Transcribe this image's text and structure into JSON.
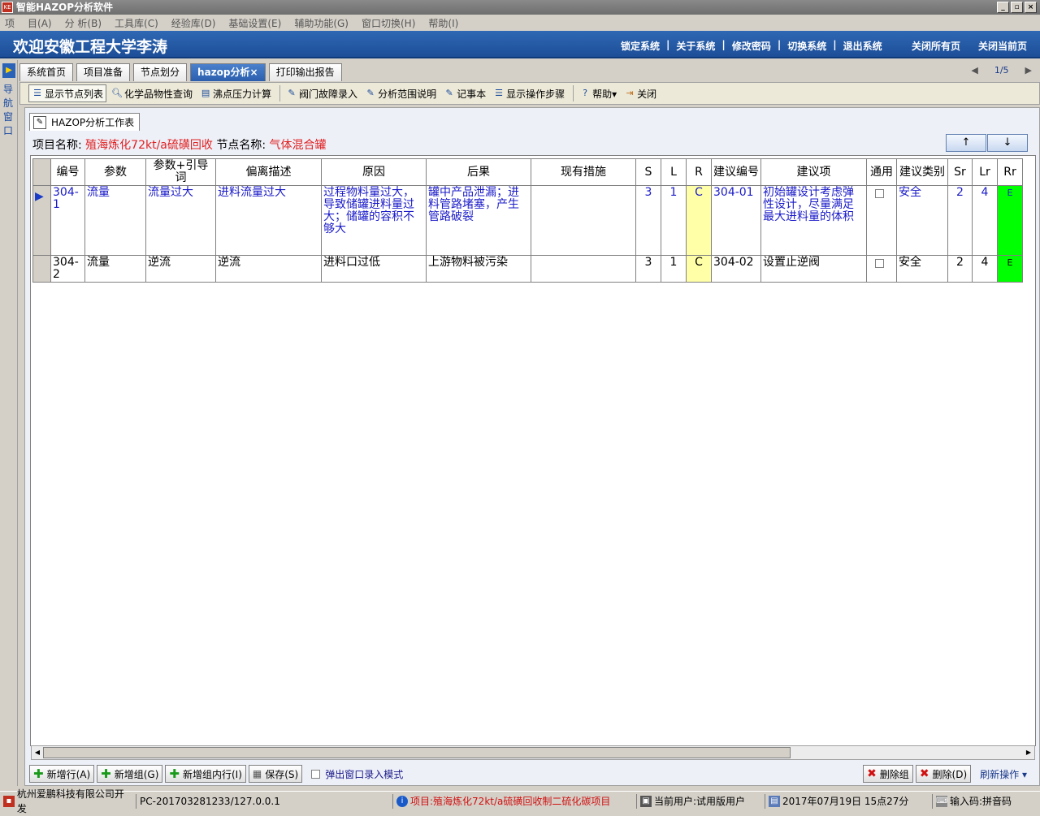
{
  "app": {
    "title": "智能HAZOP分析软件"
  },
  "menu": [
    "项",
    "目(A)",
    "分 析(B)",
    "工具库(C)",
    "经验库(D)",
    "基础设置(E)",
    "辅助功能(G)",
    "窗口切换(H)",
    "帮助(I)"
  ],
  "banner": {
    "welcome": "欢迎安徽工程大学李涛",
    "links": [
      "锁定系统",
      "关于系统",
      "修改密码",
      "切换系统",
      "退出系统"
    ],
    "right_links": [
      "关闭所有页",
      "关闭当前页"
    ]
  },
  "nav": {
    "label": "导航窗口"
  },
  "tabs": [
    "系统首页",
    "项目准备",
    "节点划分",
    "hazop分析×",
    "打印输出报告"
  ],
  "pager": {
    "text": "1/5"
  },
  "toolbar": [
    "显示节点列表",
    "化学品物性查询",
    "沸点压力计算",
    "阀门故障录入",
    "分析范围说明",
    "记事本",
    "显示操作步骤",
    "帮助▾",
    "关闭"
  ],
  "worksheet": {
    "tab": "HAZOP分析工作表",
    "project_label": "项目名称:",
    "project_value": "殖海炼化72kt/a硫磺回收",
    "node_label": "节点名称:",
    "node_value": "气体混合罐",
    "up": "↑",
    "down": "↓"
  },
  "columns": [
    "编号",
    "参数",
    "参数+引导词",
    "偏离描述",
    "原因",
    "后果",
    "现有措施",
    "S",
    "L",
    "R",
    "建议编号",
    "建议项",
    "通用",
    "建议类别",
    "Sr",
    "Lr",
    "Rr"
  ],
  "rows": [
    {
      "id": "304-1",
      "param": "流量",
      "guide": "流量过大",
      "dev": "进料流量过大",
      "cause": "过程物料量过大，导致储罐进料量过大；储罐的容积不够大",
      "cons": "罐中产品泄漏；进料管路堵塞，产生管路破裂",
      "measure": "",
      "s": "3",
      "l": "1",
      "r": "C",
      "sug_id": "304-01",
      "sug": "初始罐设计考虑弹性设计，尽量满足最大进料量的体积",
      "cat": "安全",
      "sr": "2",
      "lr": "4",
      "rr": "E"
    },
    {
      "id": "304-2",
      "param": "流量",
      "guide": "逆流",
      "dev": "逆流",
      "cause": "进料口过低",
      "cons": "上游物料被污染",
      "measure": "",
      "s": "3",
      "l": "1",
      "r": "C",
      "sug_id": "304-02",
      "sug": "设置止逆阀",
      "cat": "安全",
      "sr": "2",
      "lr": "4",
      "rr": "E"
    }
  ],
  "bottom": {
    "add_row": "新增行(A)",
    "add_group": "新增组(G)",
    "add_in_group": "新增组内行(I)",
    "save": "保存(S)",
    "popup": "弹出窗口录入模式",
    "del_group": "删除组",
    "del": "删除(D)",
    "refresh": "刷新操作 ▾"
  },
  "status": {
    "company": "杭州爱鹏科技有限公司开发",
    "pc": "PC-201703281233/127.0.0.1",
    "project": "项目:殖海炼化72kt/a硫磺回收制二硫化碳项目",
    "user": "当前用户:试用版用户",
    "datetime": "2017年07月19日 15点27分",
    "ime": "输入码:拼音码"
  },
  "colors": {
    "banner": "#2458a6",
    "active_tab": "#3a70c0",
    "red_text": "#e02020",
    "blue_text": "#1a1ac8",
    "risk_r": "#ffffa8",
    "risk_rr": "#00ff00"
  }
}
